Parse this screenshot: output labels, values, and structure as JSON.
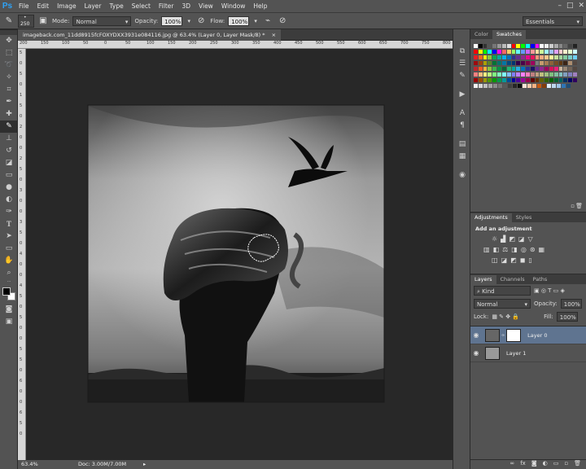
{
  "app_logo": "Ps",
  "menu": [
    "File",
    "Edit",
    "Image",
    "Layer",
    "Type",
    "Select",
    "Filter",
    "3D",
    "View",
    "Window",
    "Help"
  ],
  "window_controls": [
    "–",
    "□",
    "✕"
  ],
  "options": {
    "brush_size": "250",
    "mode_label": "Mode:",
    "mode_value": "Normal",
    "opacity_label": "Opacity:",
    "opacity_value": "100%",
    "flow_label": "Flow:",
    "flow_value": "100%",
    "workspace": "Essentials"
  },
  "document_tab": {
    "title": "imageback.com_11dd8915fcFOXYDXX3931e084116.jpg @ 63.4% (Layer 0, Layer Mask/8) *",
    "close": "×"
  },
  "ruler_top": [
    "200",
    "150",
    "100",
    "50",
    "0",
    "50",
    "100",
    "150",
    "200",
    "250",
    "300",
    "350",
    "400",
    "450",
    "500",
    "550",
    "600",
    "650",
    "700",
    "750",
    "800"
  ],
  "ruler_left": [
    "5",
    "0",
    "5",
    "0",
    "1",
    "5",
    "0",
    "2",
    "0",
    "0",
    "2",
    "5",
    "0",
    "3",
    "0",
    "0",
    "3",
    "5",
    "0",
    "4",
    "0",
    "0",
    "4",
    "5",
    "0",
    "5",
    "0",
    "0",
    "5",
    "5",
    "0",
    "6",
    "0",
    "0",
    "6",
    "5",
    "0"
  ],
  "status": {
    "zoom": "63.4%",
    "doc": "Doc: 3.00M/7.00M",
    "arrow": "▸"
  },
  "panels": {
    "color_tabs": [
      "Color",
      "Swatches"
    ],
    "adjustments_tabs": [
      "Adjustments",
      "Styles"
    ],
    "add_adjustment": "Add an adjustment",
    "layers_tabs": [
      "Layers",
      "Channels",
      "Paths"
    ],
    "kind": "Kind",
    "blend_mode": "Normal",
    "opacity_label": "Opacity:",
    "opacity_value": "100%",
    "lock_label": "Lock:",
    "fill_label": "Fill:",
    "fill_value": "100%",
    "layers": [
      {
        "name": "Layer 0",
        "selected": true
      },
      {
        "name": "Layer 1",
        "selected": false
      }
    ]
  },
  "colors": {
    "accent": "#2fa3f6",
    "selected_layer": "#5f7490"
  }
}
